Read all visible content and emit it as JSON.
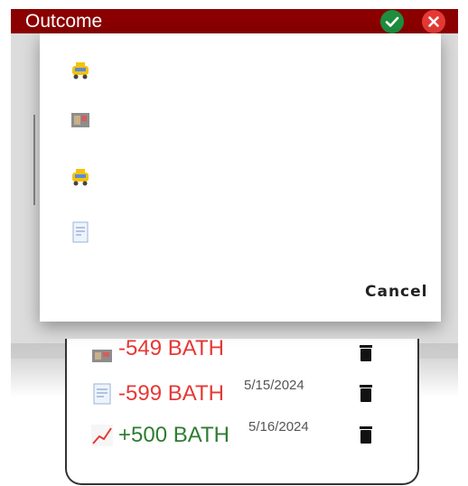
{
  "titlebar": {
    "title": "Outcome"
  },
  "dialog": {
    "options": [
      {
        "icon": "taxi-icon"
      },
      {
        "icon": "shop-icon"
      },
      {
        "icon": "taxi-icon"
      },
      {
        "icon": "receipt-icon"
      }
    ],
    "cancel_label": "Cancel"
  },
  "transactions": [
    {
      "amount": "-549 BATH",
      "date": "",
      "sign": "neg",
      "icon": "shop-icon"
    },
    {
      "amount": "-599 BATH",
      "date": "5/15/2024",
      "sign": "neg",
      "icon": "receipt-icon"
    },
    {
      "amount": "+500 BATH",
      "date": "5/16/2024",
      "sign": "pos",
      "icon": "trend-up-icon"
    }
  ],
  "colors": {
    "titlebar": "#8b0000",
    "confirm": "#1e8e3e",
    "close": "#e53935",
    "negative": "#e53935",
    "positive": "#2e7d32"
  }
}
